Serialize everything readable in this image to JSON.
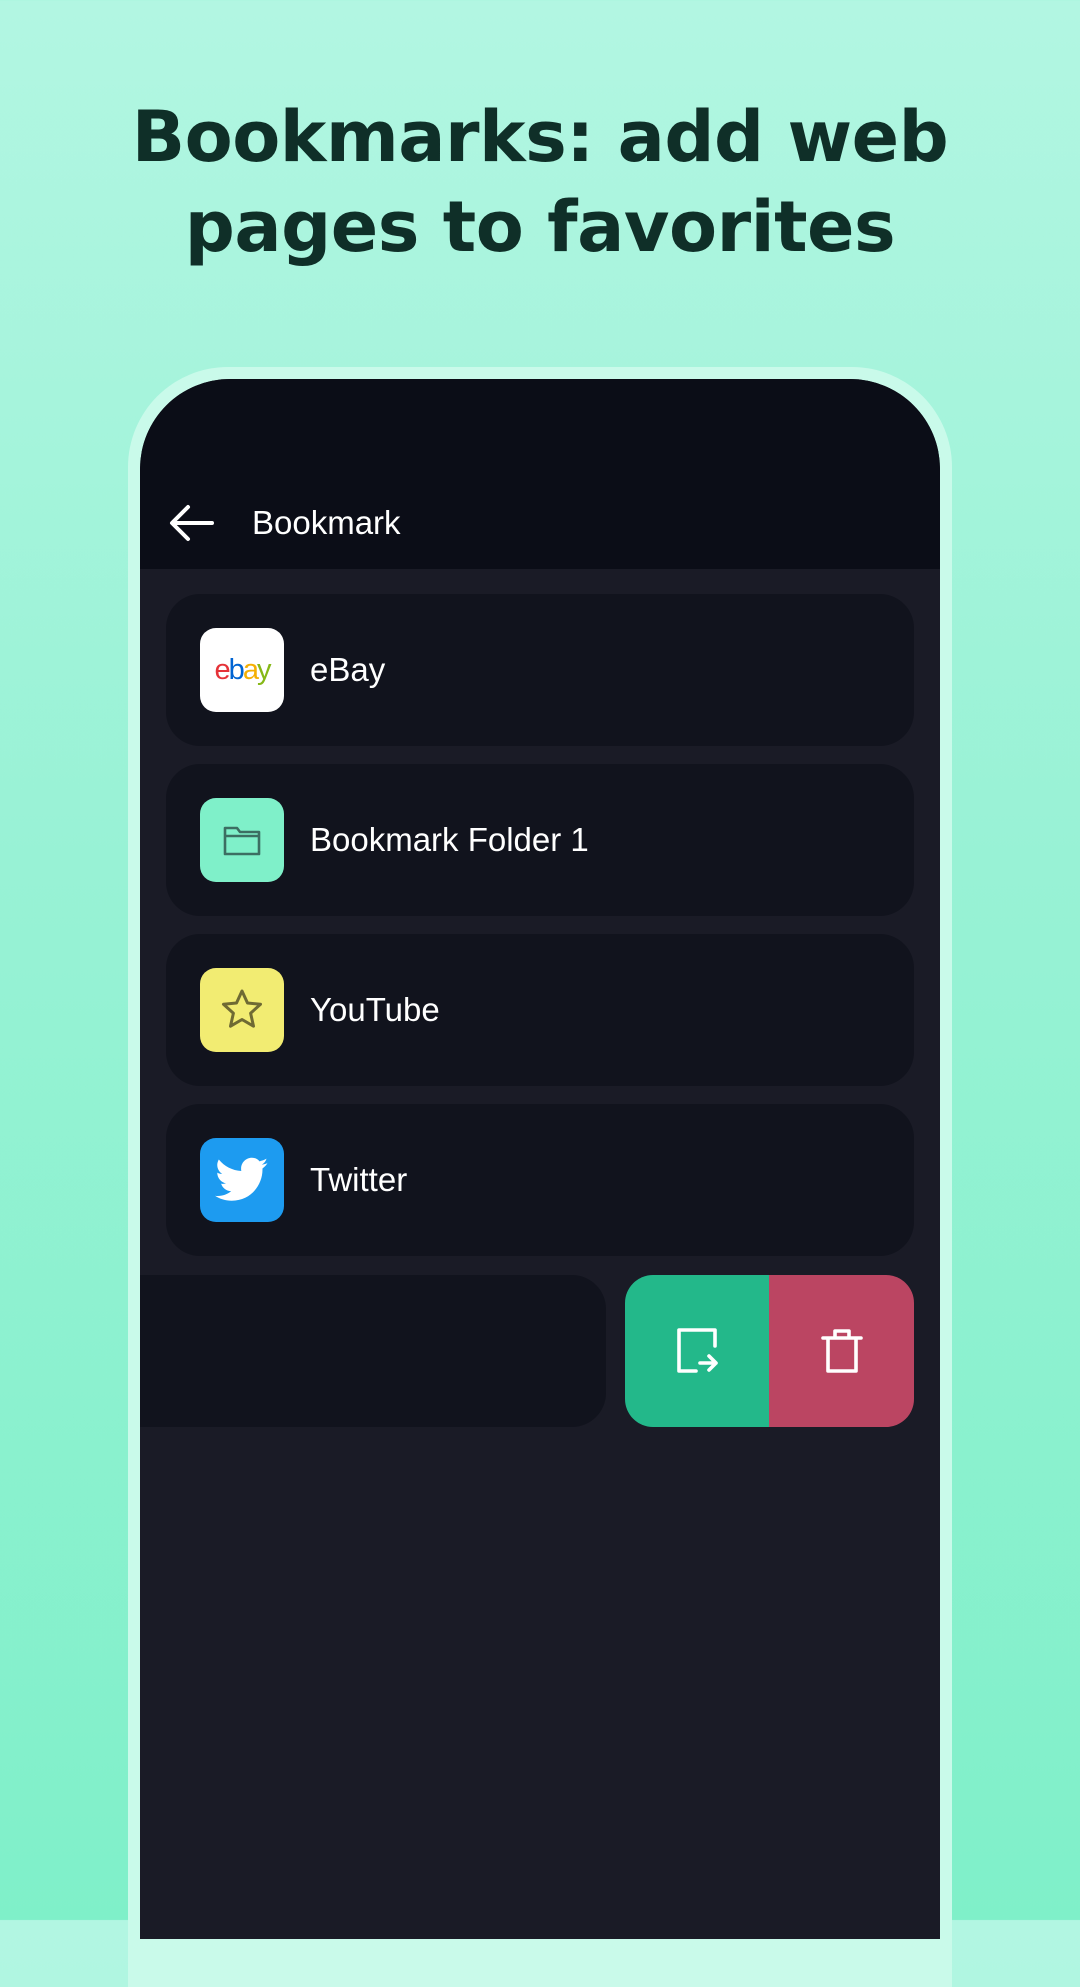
{
  "headline": "Bookmarks: add web pages to favorites",
  "header": {
    "title": "Bookmark",
    "back_icon": "arrow-left-icon"
  },
  "bookmarks": [
    {
      "label": "eBay",
      "icon": "ebay-logo",
      "icon_bg": "#ffffff",
      "logo_letters": [
        "e",
        "b",
        "a",
        "y"
      ],
      "logo_colors": [
        "#e53238",
        "#0064d2",
        "#f5af02",
        "#86b817"
      ]
    },
    {
      "label": "Bookmark Folder 1",
      "icon": "folder-icon",
      "icon_bg": "#7ff0c9"
    },
    {
      "label": "YouTube",
      "icon": "star-icon",
      "icon_bg": "#f2ec72"
    },
    {
      "label": "Twitter",
      "icon": "twitter-bird-icon",
      "icon_bg": "#1d9bf0"
    }
  ],
  "swipe_actions": {
    "move": {
      "icon": "move-to-folder-icon",
      "color": "#23b88a"
    },
    "delete": {
      "icon": "trash-icon",
      "color": "#bb4562"
    }
  },
  "colors": {
    "screen_bg": "#1a1b26",
    "header_bg": "#0b0d17",
    "card_bg": "#11131d",
    "headline_text": "#0f2f28"
  }
}
